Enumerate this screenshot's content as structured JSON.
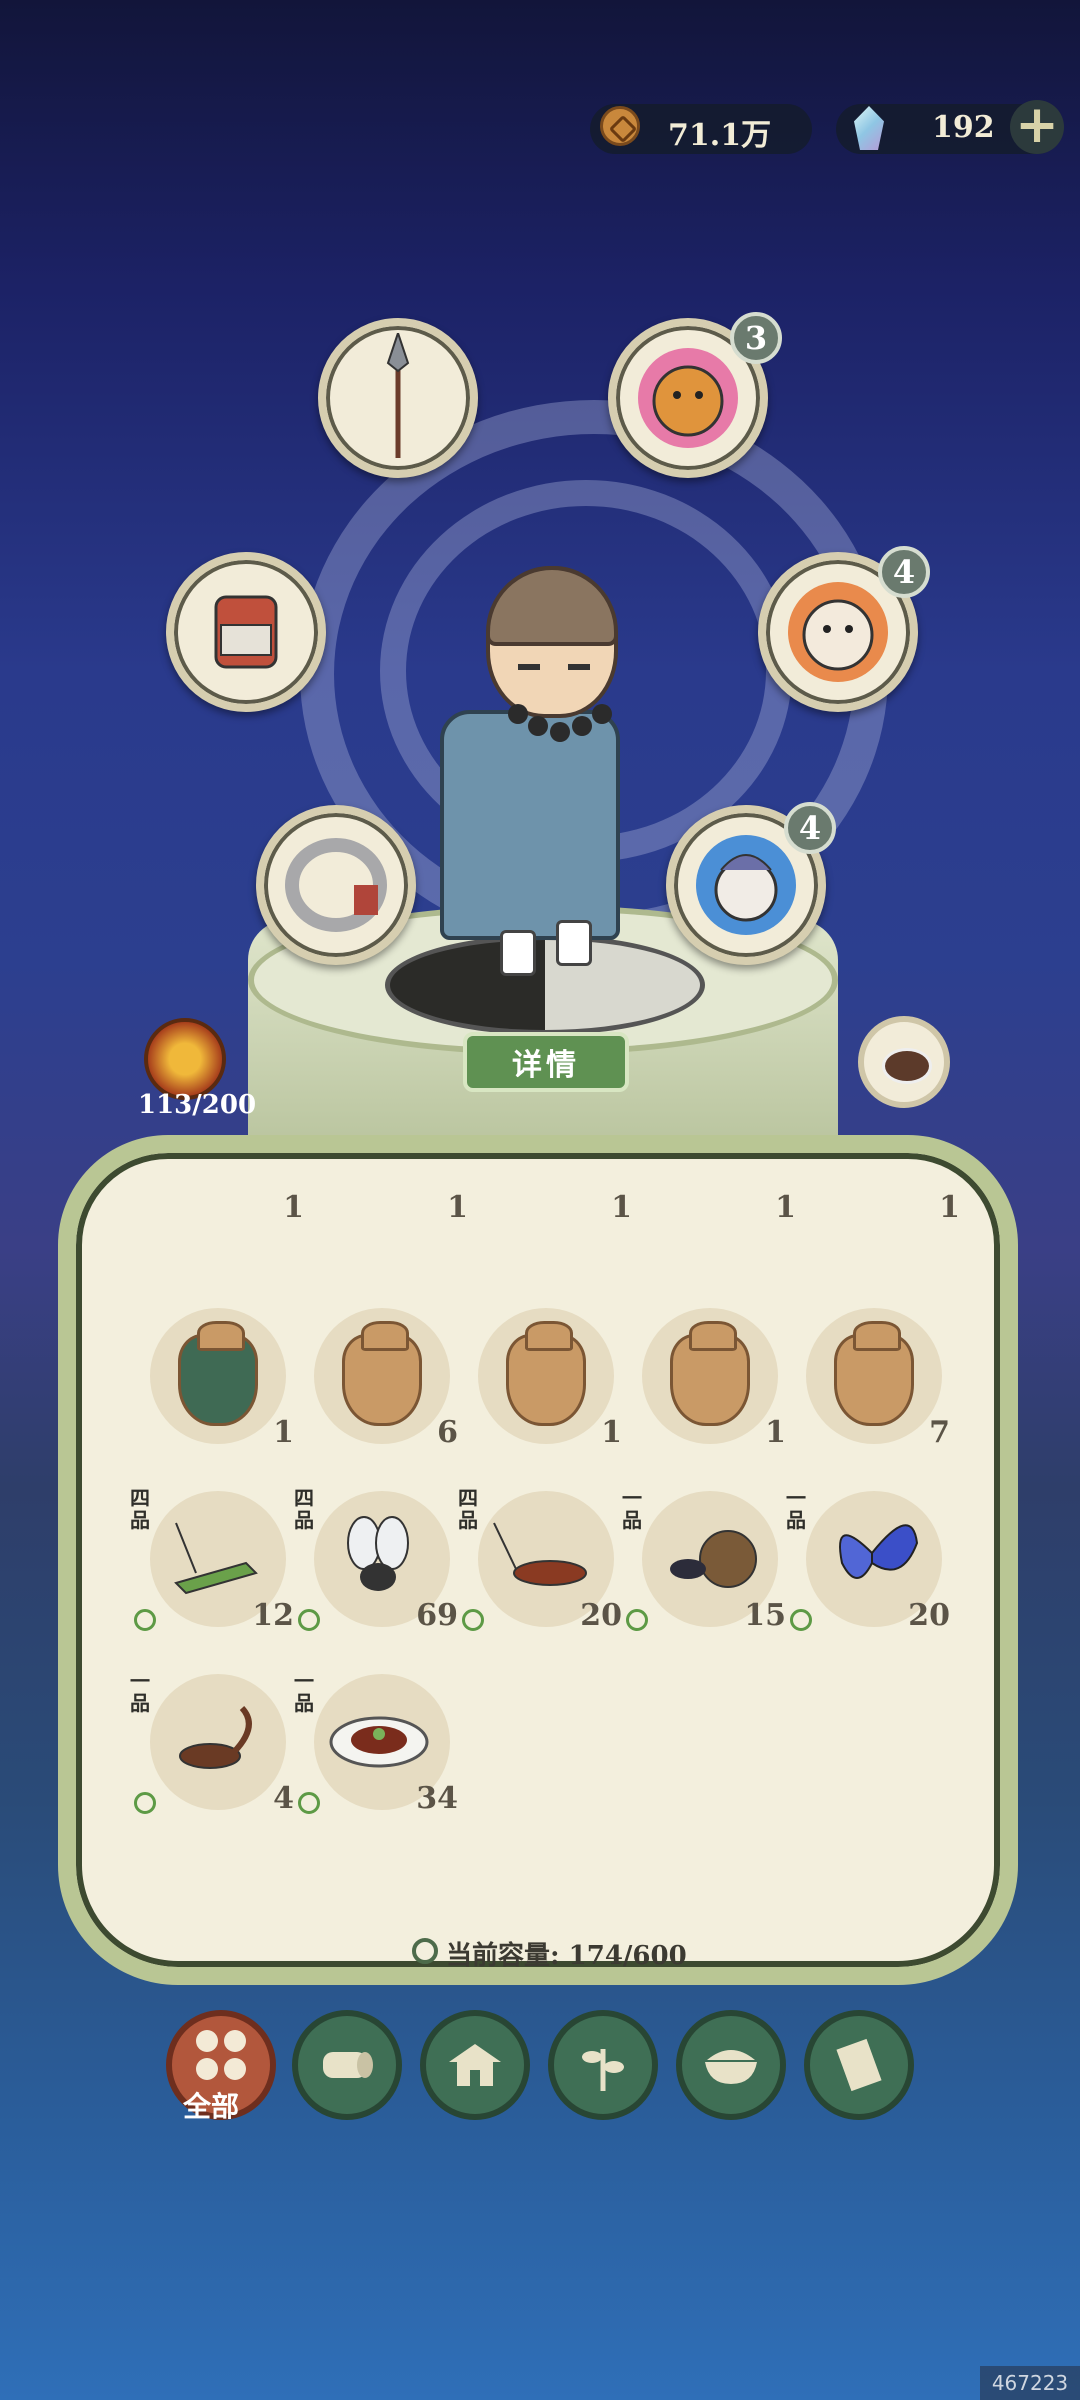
{
  "currency": {
    "coins": "71.1万",
    "gems": "192"
  },
  "equipment": {
    "pet_1_level": "3",
    "pet_2_level": "4",
    "pet_3_level": "4"
  },
  "detail_button": "详情",
  "energy": "113/200",
  "inventory": {
    "top_row_counts": [
      "1",
      "1",
      "1",
      "1",
      "1"
    ],
    "row_seeds": [
      {
        "name": "seed-bag-special",
        "count": "1"
      },
      {
        "name": "seed-bag-peach",
        "count": "6"
      },
      {
        "name": "seed-bag-flower",
        "count": "1"
      },
      {
        "name": "seed-bag-bean",
        "count": "1"
      },
      {
        "name": "seed-bag-jasmine",
        "count": "7"
      }
    ],
    "row_insects": [
      {
        "name": "grasshopper",
        "grade": "四品",
        "count": "12"
      },
      {
        "name": "fly",
        "grade": "四品",
        "count": "69"
      },
      {
        "name": "cockroach",
        "grade": "四品",
        "count": "20"
      },
      {
        "name": "dung-beetle",
        "grade": "一品",
        "count": "15"
      },
      {
        "name": "butterfly",
        "grade": "一品",
        "count": "20"
      }
    ],
    "row_misc": [
      {
        "name": "scorpion",
        "grade": "一品",
        "count": "4"
      },
      {
        "name": "dish",
        "grade": "一品",
        "count": "34"
      }
    ],
    "capacity_label": "当前容量: 174/600"
  },
  "tabs": {
    "all_label": "全部"
  },
  "watermark": "467223"
}
